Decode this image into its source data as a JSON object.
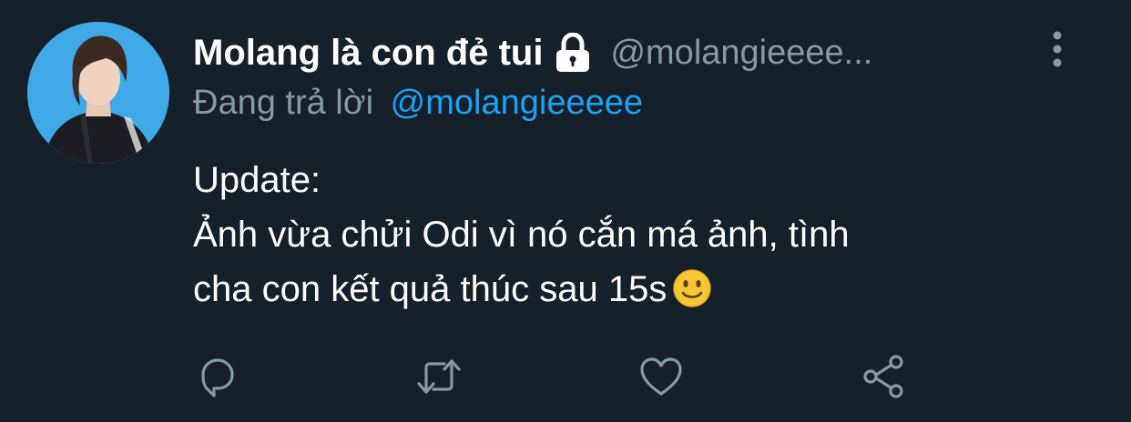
{
  "tweet": {
    "display_name": "Molang là con đẻ tui",
    "handle": "@molangieeee...",
    "reply_prefix": "Đang trả lời",
    "reply_mention": "@molangieeeee",
    "text_lines": [
      "Update:",
      "Ảnh vừa chửi Odi vì nó cắn má ảnh, tình",
      "cha con kết quả thúc sau 15s"
    ],
    "emoji": "🙂"
  },
  "icons": {
    "lock": "lock-icon",
    "more": "more-vertical-icon",
    "reply": "reply-icon",
    "retweet": "retweet-icon",
    "like": "heart-icon",
    "share": "share-icon"
  },
  "colors": {
    "background": "#15202b",
    "primary_text": "#ffffff",
    "secondary_text": "#8899a6",
    "link": "#1da1f2",
    "avatar_background": "#3ea9e6"
  }
}
